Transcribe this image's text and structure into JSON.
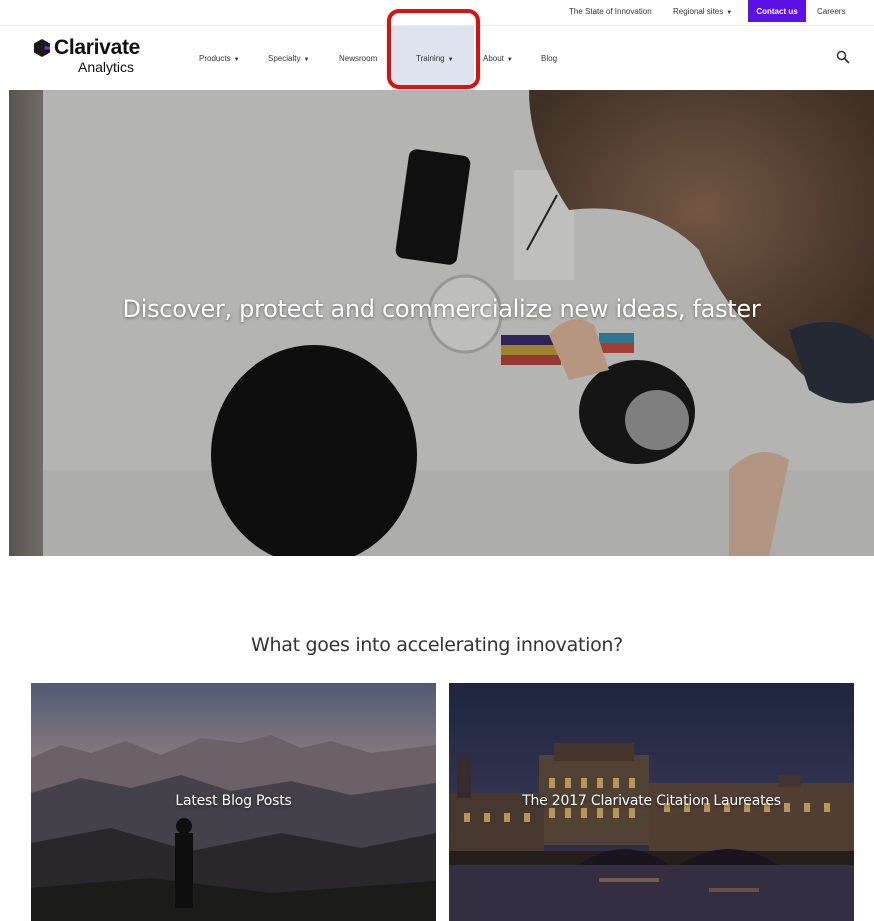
{
  "utility": {
    "state_of_innovation": "The State of Innovation",
    "regional_sites": "Regional sites",
    "contact_us": "Contact us",
    "careers": "Careers"
  },
  "brand": {
    "name": "Clarivate",
    "sub": "Analytics"
  },
  "nav": {
    "products": "Products",
    "specialty": "Specialty",
    "newsroom": "Newsroom",
    "training": "Training",
    "about": "About",
    "blog": "Blog"
  },
  "hero": {
    "heading": "Discover, protect and commercialize new ideas, faster"
  },
  "section": {
    "title": "What goes into accelerating innovation?"
  },
  "cards": [
    {
      "title": "Latest Blog Posts"
    },
    {
      "title": "The 2017 Clarivate Citation Laureates"
    }
  ],
  "colors": {
    "accent": "#5b10e6",
    "highlight": "#e10e0e",
    "training_bg": "#dde3ef"
  }
}
